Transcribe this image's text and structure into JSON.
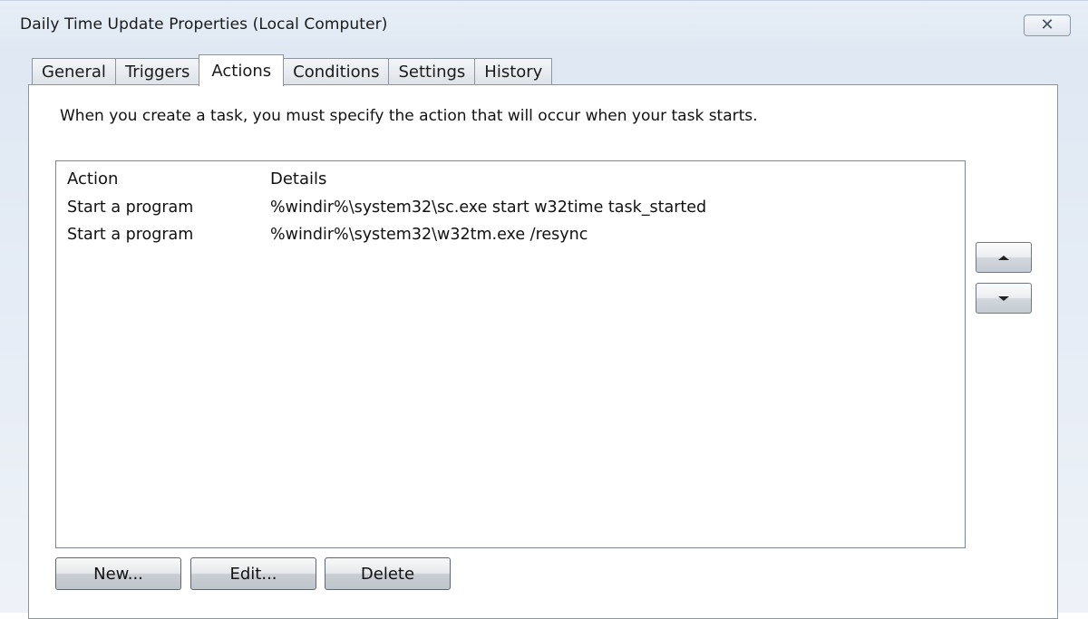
{
  "window": {
    "title": "Daily Time Update Properties (Local Computer)",
    "close_glyph": "✕"
  },
  "tabs": [
    {
      "label": "General",
      "active": false
    },
    {
      "label": "Triggers",
      "active": false
    },
    {
      "label": "Actions",
      "active": true
    },
    {
      "label": "Conditions",
      "active": false
    },
    {
      "label": "Settings",
      "active": false
    },
    {
      "label": "History",
      "active": false
    }
  ],
  "actions_panel": {
    "instruction": "When you create a task, you must specify the action that will occur when your task starts.",
    "columns": {
      "action": "Action",
      "details": "Details"
    },
    "rows": [
      {
        "action": "Start a program",
        "details": "%windir%\\system32\\sc.exe start w32time task_started"
      },
      {
        "action": "Start a program",
        "details": "%windir%\\system32\\w32tm.exe /resync"
      }
    ],
    "move_up_icon": "arrow-up",
    "move_down_icon": "arrow-down"
  },
  "buttons": {
    "new": "New...",
    "edit": "Edit...",
    "delete": "Delete"
  }
}
